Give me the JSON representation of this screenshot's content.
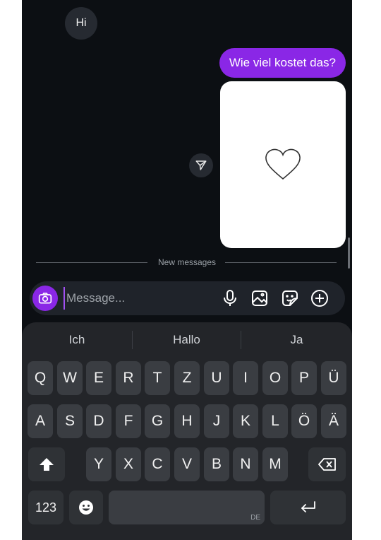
{
  "chat": {
    "incoming_text": "Hi",
    "outgoing_text": "Wie viel kostet das?",
    "new_messages_label": "New messages"
  },
  "composer": {
    "placeholder": "Message..."
  },
  "colors": {
    "accent": "#8a27e6",
    "background": "#0c0f13",
    "bubble_incoming": "#262a31"
  },
  "icons": [
    "camera-icon",
    "microphone-icon",
    "gallery-icon",
    "sticker-icon",
    "plus-icon",
    "share-icon",
    "heart-icon",
    "shift-icon",
    "backspace-icon",
    "emoji-icon",
    "enter-icon"
  ],
  "keyboard": {
    "suggestions": [
      "Ich",
      "Hallo",
      "Ja"
    ],
    "row1": [
      "Q",
      "W",
      "E",
      "R",
      "T",
      "Z",
      "U",
      "I",
      "O",
      "P",
      "Ü"
    ],
    "row2": [
      "A",
      "S",
      "D",
      "F",
      "G",
      "H",
      "J",
      "K",
      "L",
      "Ö",
      "Ä"
    ],
    "row3": [
      "Y",
      "X",
      "C",
      "V",
      "B",
      "N",
      "M"
    ],
    "numbers_label": "123",
    "space_lang": "DE"
  }
}
